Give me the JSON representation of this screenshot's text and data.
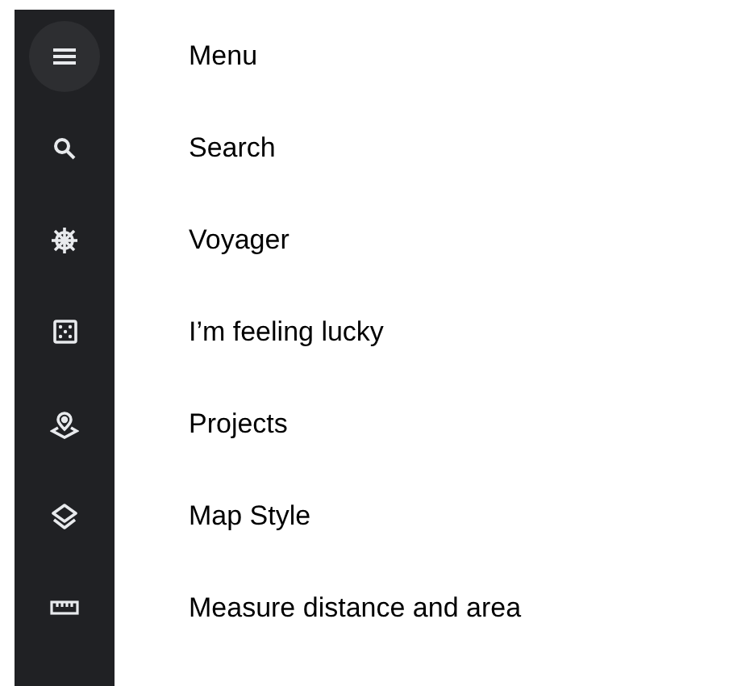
{
  "sidebar": {
    "items": [
      {
        "kind": "menu",
        "label": "Menu",
        "selected": true
      },
      {
        "kind": "search",
        "label": "Search",
        "selected": false
      },
      {
        "kind": "voyager",
        "label": "Voyager",
        "selected": false
      },
      {
        "kind": "lucky",
        "label": "I’m feeling lucky",
        "selected": false
      },
      {
        "kind": "projects",
        "label": "Projects",
        "selected": false
      },
      {
        "kind": "style",
        "label": "Map Style",
        "selected": false
      },
      {
        "kind": "measure",
        "label": "Measure distance and area",
        "selected": false
      }
    ]
  }
}
